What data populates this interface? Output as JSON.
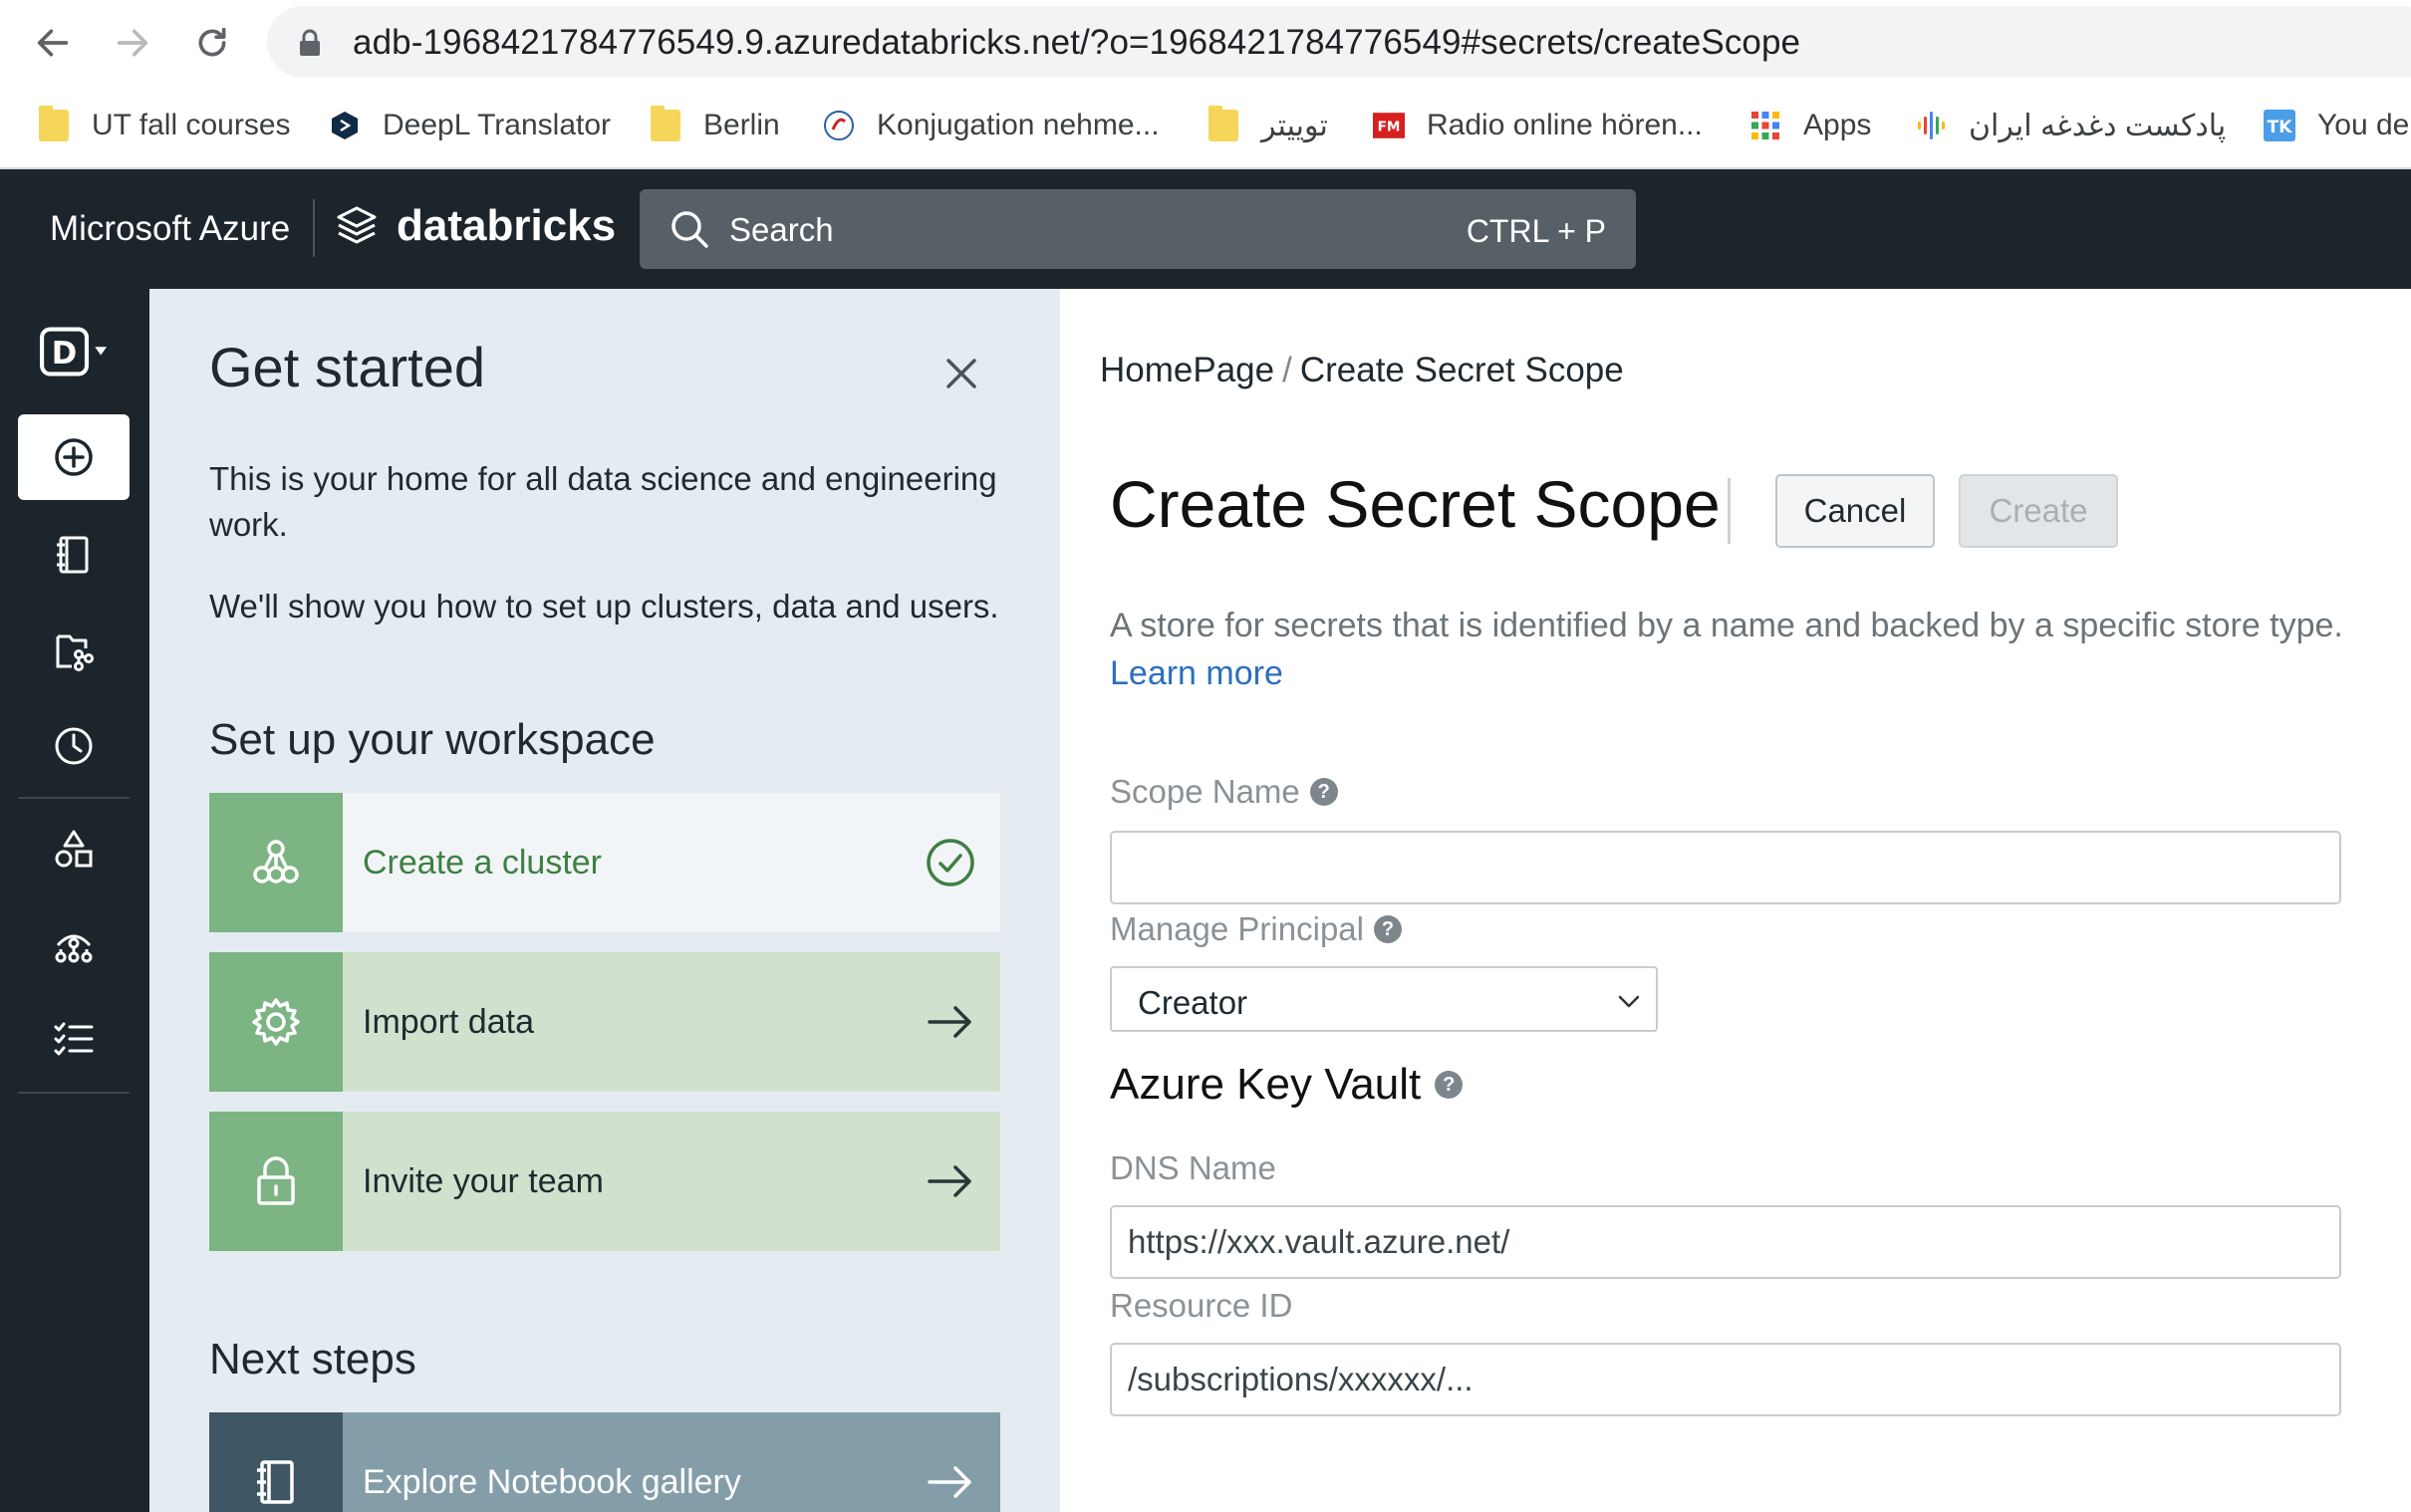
{
  "browser": {
    "url": "adb-1968421784776549.9.azuredatabricks.net/?o=1968421784776549#secrets/createScope",
    "bookmarks": [
      {
        "label": "UT fall courses",
        "icon": "folder-icon"
      },
      {
        "label": "DeepL Translator",
        "icon": "deepl-icon"
      },
      {
        "label": "Berlin",
        "icon": "folder-icon"
      },
      {
        "label": "Konjugation nehme...",
        "icon": "konjugation-icon"
      },
      {
        "label": "توییتر",
        "icon": "folder-icon"
      },
      {
        "label": "Radio online hören...",
        "icon": "fm-icon"
      },
      {
        "label": "Apps",
        "icon": "apps-grid-icon"
      },
      {
        "label": "پادکست دغدغه ایران",
        "icon": "podcast-icon"
      },
      {
        "label": "You de",
        "icon": "tk-icon"
      }
    ]
  },
  "topbar": {
    "brand_azure": "Microsoft Azure",
    "brand_db": "databricks",
    "search_label": "Search",
    "search_shortcut": "CTRL + P"
  },
  "rail": {
    "workspace_letter": "D"
  },
  "panel": {
    "title": "Get started",
    "text1": "This is your home for all data science and engineering work.",
    "text2": "We'll show you how to set up clusters, data and users.",
    "setup_title": "Set up your workspace",
    "cards": [
      {
        "label": "Create a cluster"
      },
      {
        "label": "Import data"
      },
      {
        "label": "Invite your team"
      }
    ],
    "next_title": "Next steps",
    "next_cards": [
      {
        "label": "Explore Notebook gallery"
      }
    ]
  },
  "main": {
    "breadcrumb_home": "HomePage",
    "breadcrumb_sep": "/",
    "breadcrumb_current": "Create Secret Scope",
    "title": "Create Secret Scope",
    "cancel_label": "Cancel",
    "create_label": "Create",
    "description": "A store for secrets that is identified by a name and backed by a specific store type.",
    "learn_more": "Learn more",
    "scope_name_label": "Scope Name",
    "scope_name_value": "",
    "manage_principal_label": "Manage Principal",
    "manage_principal_value": "Creator",
    "key_vault_title": "Azure Key Vault",
    "dns_label": "DNS Name",
    "dns_placeholder": "https://xxx.vault.azure.net/",
    "resource_label": "Resource ID",
    "resource_placeholder": "/subscriptions/xxxxxx/..."
  },
  "colors": {
    "topbar": "#1b252b",
    "panel": "#e5ecf1",
    "card_green": "#7cb483",
    "card_light_green": "#d0e2cd",
    "link": "#2d6ebd"
  }
}
